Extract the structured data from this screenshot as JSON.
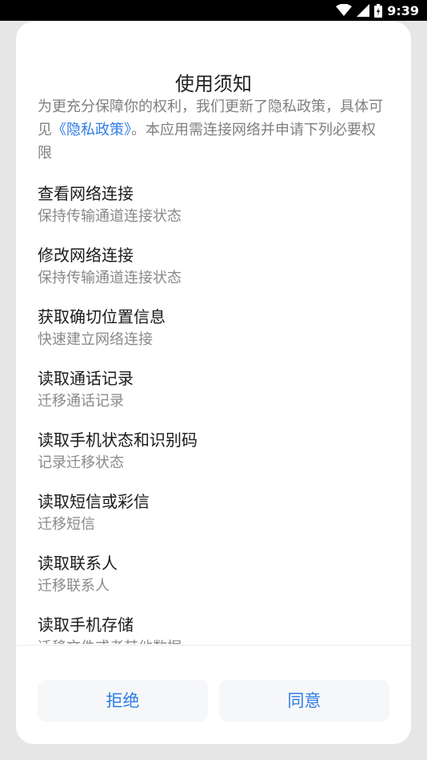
{
  "status_bar": {
    "time": "9:39",
    "icons": [
      "wifi-icon",
      "signal-icon",
      "battery-icon"
    ]
  },
  "dialog": {
    "title": "使用须知",
    "intro_prefix": "为更充分保障你的权利，我们更新了隐私政策，具体可见",
    "intro_link": "《隐私政策》",
    "intro_suffix": "。本应用需连接网络并申请下列必要权限",
    "permissions": [
      {
        "title": "查看网络连接",
        "desc": "保持传输通道连接状态"
      },
      {
        "title": "修改网络连接",
        "desc": "保持传输通道连接状态"
      },
      {
        "title": "获取确切位置信息",
        "desc": "快速建立网络连接"
      },
      {
        "title": "读取通话记录",
        "desc": "迁移通话记录"
      },
      {
        "title": "读取手机状态和识别码",
        "desc": "记录迁移状态"
      },
      {
        "title": "读取短信或彩信",
        "desc": "迁移短信"
      },
      {
        "title": "读取联系人",
        "desc": "迁移联系人"
      },
      {
        "title": "读取手机存储",
        "desc": "迁移文件或者其他数据"
      }
    ],
    "reject_label": "拒绝",
    "agree_label": "同意"
  },
  "colors": {
    "accent": "#2f7de6",
    "background": "#e6e6e6",
    "dialog": "#ffffff",
    "button_bg": "#f6f7f8"
  }
}
